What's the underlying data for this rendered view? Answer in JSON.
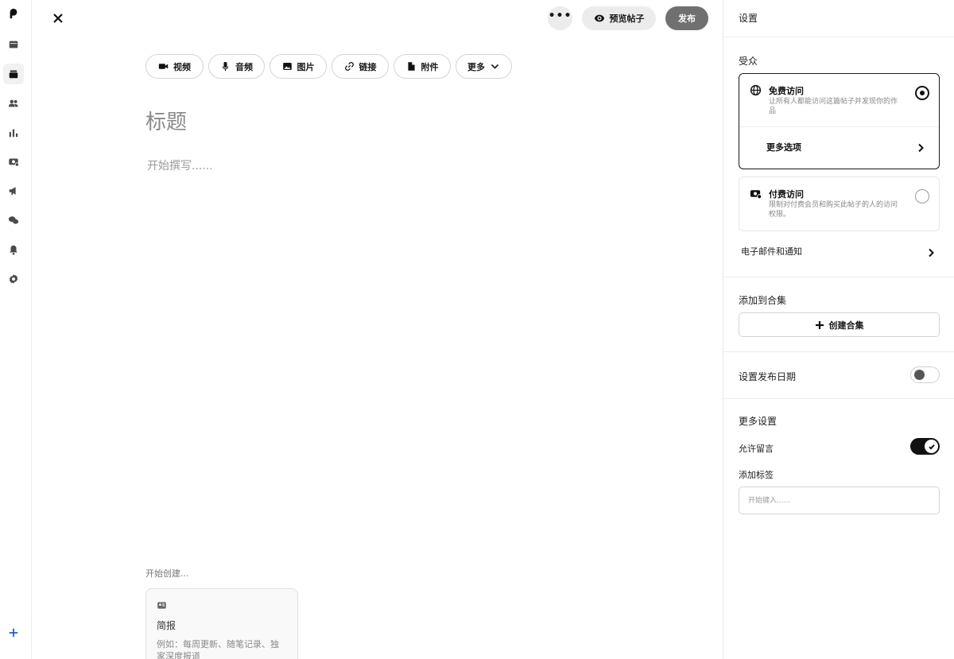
{
  "topbar": {
    "more_label": "•••",
    "preview_label": "预览帖子",
    "publish_label": "发布"
  },
  "rail": {
    "icons": [
      "logo-icon",
      "home-icon",
      "posts-icon",
      "members-icon",
      "insights-icon",
      "payouts-icon",
      "promotions-icon",
      "chats-icon",
      "notifications-icon",
      "settings-icon",
      "add-icon"
    ]
  },
  "toolbar": {
    "items": [
      {
        "label": "视频",
        "icon": "video-icon"
      },
      {
        "label": "音频",
        "icon": "mic-icon"
      },
      {
        "label": "图片",
        "icon": "image-icon"
      },
      {
        "label": "链接",
        "icon": "link-icon"
      },
      {
        "label": "附件",
        "icon": "file-icon"
      },
      {
        "label": "更多",
        "icon": "chevron-down-icon"
      }
    ]
  },
  "editor": {
    "title_placeholder": "标题",
    "body_placeholder": "开始撰写......"
  },
  "templates": {
    "heading": "开始创建...",
    "card": {
      "name": "简报",
      "description": "例如：每周更新、随笔记录、独家深度报道"
    }
  },
  "settings": {
    "header": "设置",
    "audience": {
      "title": "受众",
      "free": {
        "name": "免费访问",
        "description": "让所有人都能访问这篇帖子并发现你的作品",
        "selected": true
      },
      "more_options": "更多选项",
      "paid": {
        "name": "付费访问",
        "description": "限制对付费会员和购买此帖子的人的访问权限。",
        "selected": false
      },
      "email_notifications": "电子邮件和通知"
    },
    "collection": {
      "title": "添加到合集",
      "create_button": "创建合集"
    },
    "schedule": {
      "label": "设置发布日期",
      "enabled": false
    },
    "more_settings": {
      "title": "更多设置",
      "allow_comments": "允许留言",
      "comments_enabled": true,
      "add_tags": "添加标签",
      "tags_placeholder": "开始键入......"
    }
  }
}
